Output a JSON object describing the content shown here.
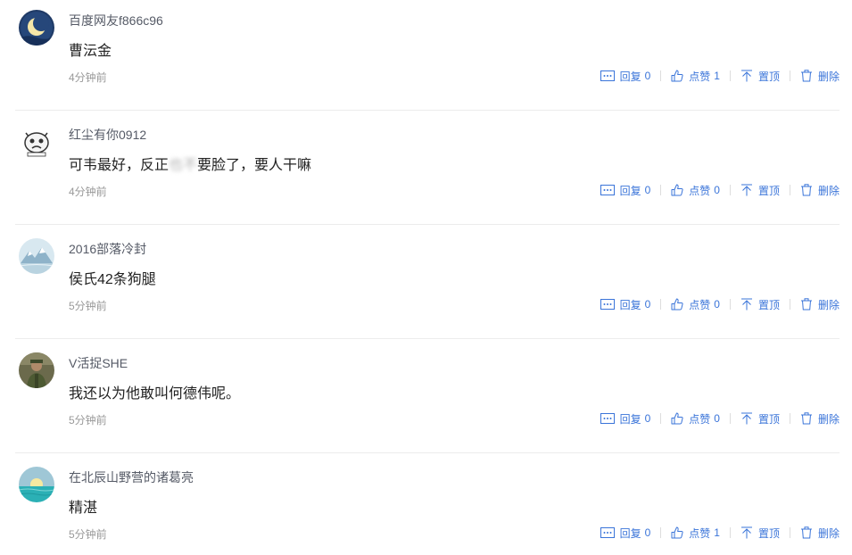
{
  "comments": [
    {
      "username": "百度网友f866c96",
      "avatar": "moon-night-avatar",
      "content_before": "曹沄金",
      "content_blurred": "",
      "content_after": "",
      "time": "4分钟前",
      "reply_label": "回复",
      "reply_count": "0",
      "like_label": "点赞",
      "like_count": "1",
      "pin_label": "置顶",
      "delete_label": "删除"
    },
    {
      "username": "红尘有你0912",
      "avatar": "cartoon-face-avatar",
      "content_before": "可韦最好，反正",
      "content_blurred": "也不",
      "content_after": "要脸了，要人干嘛",
      "time": "4分钟前",
      "reply_label": "回复",
      "reply_count": "0",
      "like_label": "点赞",
      "like_count": "0",
      "pin_label": "置顶",
      "delete_label": "删除"
    },
    {
      "username": "2016部落冷封",
      "avatar": "snow-mountain-avatar",
      "content_before": "侯氏42条狗腿",
      "content_blurred": "",
      "content_after": "",
      "time": "5分钟前",
      "reply_label": "回复",
      "reply_count": "0",
      "like_label": "点赞",
      "like_count": "0",
      "pin_label": "置顶",
      "delete_label": "删除"
    },
    {
      "username": "V活捉SHE",
      "avatar": "person-photo-avatar",
      "content_before": "我还以为他敢叫何德伟呢。",
      "content_blurred": "",
      "content_after": "",
      "time": "5分钟前",
      "reply_label": "回复",
      "reply_count": "0",
      "like_label": "点赞",
      "like_count": "0",
      "pin_label": "置顶",
      "delete_label": "删除"
    },
    {
      "username": "在北辰山野营的诸葛亮",
      "avatar": "sunset-sea-avatar",
      "content_before": "精湛",
      "content_blurred": "",
      "content_after": "",
      "time": "5分钟前",
      "reply_label": "回复",
      "reply_count": "0",
      "like_label": "点赞",
      "like_count": "1",
      "pin_label": "置顶",
      "delete_label": "删除"
    }
  ],
  "colors": {
    "action_blue": "#3a74d9",
    "username": "#555a66",
    "time": "#999999",
    "divider": "#ececec"
  }
}
